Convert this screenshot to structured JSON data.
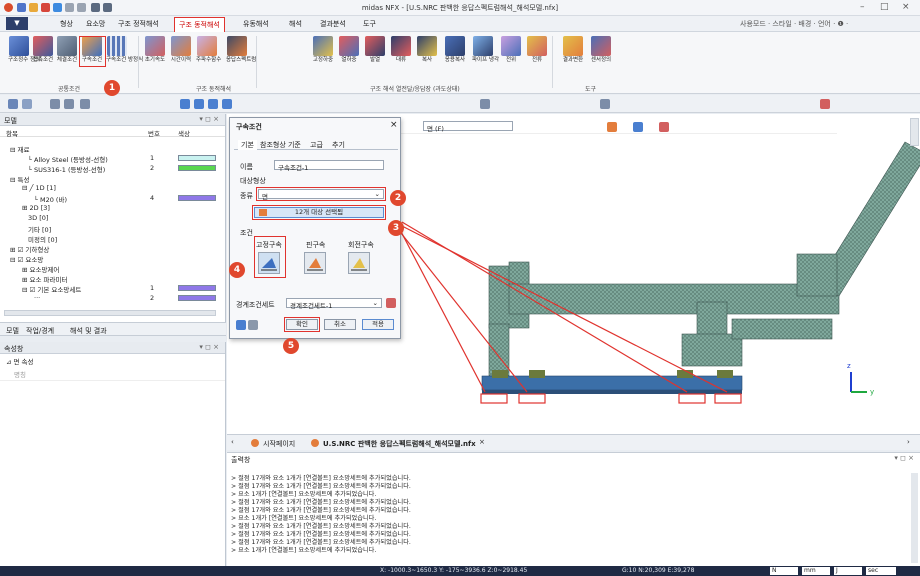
{
  "window": {
    "title": "midas NFX - [U.S.NRC 판백한 응답스펙트럼해석_해석모델.nfx]",
    "search": "사용모드 · 스타일 · 배경 · 언어 · ❶ ·"
  },
  "menu": {
    "file": "▼",
    "tabs": [
      "형상",
      "요소망",
      "구조 정적해석",
      "구조 동적해석",
      "유동해석",
      "해석",
      "결과분석",
      "도구"
    ]
  },
  "ribbon": {
    "buttons": [
      "구조정수 정의·",
      "접촉조건",
      "체결조건",
      "구속조건",
      "구속조건 방정식",
      "초기속도",
      "시간이력",
      "주파수함수",
      "응답스펙트럼",
      "고정하중",
      "열하중",
      "발열",
      "대류",
      "복사",
      "응용복사",
      "파이프 냉각",
      "전위",
      "전류",
      "결과변환",
      "센서정의"
    ],
    "groups": [
      "공통조건",
      "구조 동적해석",
      "구조 해석 열전달/응답장 (과도상태)",
      "도구"
    ]
  },
  "left_panel": {
    "title": "모델",
    "columns": [
      "항목",
      "번호",
      "색상"
    ],
    "rows": [
      {
        "label": "재료",
        "no": ""
      },
      {
        "label": "Alloy Steel (등방성-선형)",
        "no": "1",
        "color": "#c9f2f0"
      },
      {
        "label": "SUS316-1 (등방성-선형)",
        "no": "2",
        "color": "#59d64f"
      },
      {
        "label": "특성",
        "no": ""
      },
      {
        "label": "1D [1]",
        "no": ""
      },
      {
        "label": "M20 (바)",
        "no": "4",
        "color": "#8f78e8"
      },
      {
        "label": "2D [3]",
        "no": ""
      },
      {
        "label": "3D [0]",
        "no": ""
      },
      {
        "label": "기타 [0]",
        "no": ""
      },
      {
        "label": "미정의 [0]",
        "no": ""
      },
      {
        "label": "기하형상",
        "no": ""
      },
      {
        "label": "요소망",
        "no": ""
      },
      {
        "label": "요소망제어",
        "no": ""
      },
      {
        "label": "요소 파라미터",
        "no": ""
      },
      {
        "label": "기본 요소망세트",
        "no": "1",
        "color": "#8f78e8"
      },
      {
        "label": "···",
        "no": "2",
        "color": "#8f78e8"
      }
    ],
    "tabs": [
      "모델",
      "작업/경계",
      "해석 및 결과"
    ]
  },
  "props": {
    "title": "속성창",
    "section": "면 속성",
    "row": "명칭"
  },
  "dialog": {
    "title": "구속조건",
    "tabs": [
      "기본",
      "참조형상 기준",
      "고급",
      "추기"
    ],
    "name_label": "이름",
    "name_value": "구속조건-1",
    "target_label": "대상형상",
    "type_label": "종류",
    "type_value": "면",
    "select_button": "12개 대상 선택됨",
    "condition_label": "조건",
    "conditions": [
      "고정구속",
      "핀구속",
      "회전구속"
    ],
    "boundary_label": "경계조건세트",
    "boundary_value": "경계조건세트-1",
    "buttons": [
      "확인",
      "취소",
      "적용"
    ]
  },
  "viewport": {
    "filter": "면 (F)",
    "axis_z": "z",
    "axis_y": "y"
  },
  "badges": [
    "1",
    "2",
    "3",
    "4",
    "5"
  ],
  "doc_tabs": [
    "시작페이지",
    "U.S.NRC 판백한 응답스펙트럼해석_해석모델.nfx"
  ],
  "output": {
    "title": "출력창",
    "lines": [
      "> 절점 17개와 요소 1개가 [연결볼트] 요소망세트에 추가되었습니다.",
      "> 절점 17개와 요소 1개가 [연결볼트] 요소망세트에 추가되었습니다.",
      "> 요소 1개가 [연결볼트] 요소망세트에 추가되었습니다.",
      "> 절점 17개와 요소 1개가 [연결볼트] 요소망세트에 추가되었습니다.",
      "> 절점 17개와 요소 1개가 [연결볼트] 요소망세트에 추가되었습니다.",
      "> 요소 1개가 [연결볼트] 요소망세트에 추가되었습니다.",
      "> 절점 17개와 요소 1개가 [연결볼트] 요소망세트에 추가되었습니다.",
      "> 절점 17개와 요소 1개가 [연결볼트] 요소망세트에 추가되었습니다.",
      "> 절점 17개와 요소 1개가 [연결볼트] 요소망세트에 추가되었습니다.",
      "> 요소 1개가 [연결볼트] 요소망세트에 추가되었습니다."
    ]
  },
  "status": {
    "coords": "X: -1000.3~1650.3 Y: -175~3936.6 Z:0~2918.45",
    "grid": "G:10 N:20,309 E:39,278",
    "unit1": "N",
    "unit2": "mm",
    "unit3": "J",
    "unit4": "sec"
  },
  "colors": {
    "accent": "#e0332e",
    "badge": "#e0482e",
    "status_bg": "#1f2a44",
    "mesh": "#7fa89c"
  }
}
